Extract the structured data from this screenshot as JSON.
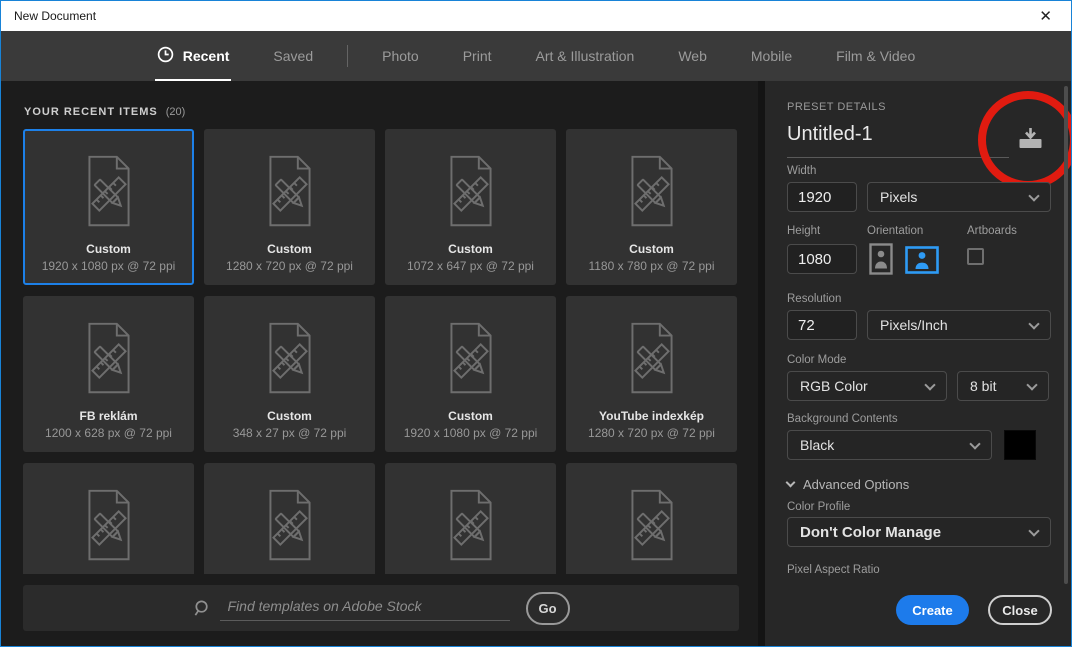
{
  "window": {
    "title": "New Document",
    "close_glyph": "✕"
  },
  "tabs": [
    {
      "label": "Recent",
      "active": true,
      "icon": "clock"
    },
    {
      "label": "Saved",
      "divider_after": true
    },
    {
      "label": "Photo"
    },
    {
      "label": "Print"
    },
    {
      "label": "Art & Illustration"
    },
    {
      "label": "Web"
    },
    {
      "label": "Mobile"
    },
    {
      "label": "Film & Video"
    }
  ],
  "recent": {
    "heading": "YOUR RECENT ITEMS",
    "count": "(20)"
  },
  "cards": [
    {
      "title": "Custom",
      "meta": "1920 x 1080 px @ 72 ppi",
      "selected": true
    },
    {
      "title": "Custom",
      "meta": "1280 x 720 px @ 72 ppi"
    },
    {
      "title": "Custom",
      "meta": "1072 x 647 px @ 72 ppi"
    },
    {
      "title": "Custom",
      "meta": "1180 x 780 px @ 72 ppi"
    },
    {
      "title": "FB reklám",
      "meta": "1200 x 628 px @ 72 ppi"
    },
    {
      "title": "Custom",
      "meta": "348 x 27 px @ 72 ppi"
    },
    {
      "title": "Custom",
      "meta": "1920 x 1080 px @ 72 ppi"
    },
    {
      "title": "YouTube indexkép",
      "meta": "1280 x 720 px @ 72 ppi"
    },
    {
      "title": "",
      "meta": "",
      "partial": true
    },
    {
      "title": "",
      "meta": "",
      "partial": true
    },
    {
      "title": "",
      "meta": "",
      "partial": true
    },
    {
      "title": "",
      "meta": "",
      "partial": true
    }
  ],
  "search": {
    "placeholder": "Find templates on Adobe Stock",
    "go_label": "Go"
  },
  "preset": {
    "heading": "PRESET DETAILS",
    "name": "Untitled-1",
    "width": {
      "label": "Width",
      "value": "1920",
      "unit": "Pixels"
    },
    "height": {
      "label": "Height",
      "value": "1080"
    },
    "orientation_label": "Orientation",
    "artboards_label": "Artboards",
    "resolution": {
      "label": "Resolution",
      "value": "72",
      "unit": "Pixels/Inch"
    },
    "color_mode": {
      "label": "Color Mode",
      "value": "RGB Color",
      "depth": "8 bit"
    },
    "background": {
      "label": "Background Contents",
      "value": "Black"
    },
    "advanced_label": "Advanced Options",
    "color_profile": {
      "label": "Color Profile",
      "value": "Don't Color Manage"
    },
    "pixel_aspect_label": "Pixel Aspect Ratio",
    "create_label": "Create",
    "close_label": "Close"
  },
  "colors": {
    "accent_blue": "#1d7beb",
    "selection_blue": "#1d80e8",
    "orientation_blue": "#2e9bf5",
    "annotation_red": "#e11b10",
    "frame_blue": "#1883d7"
  }
}
